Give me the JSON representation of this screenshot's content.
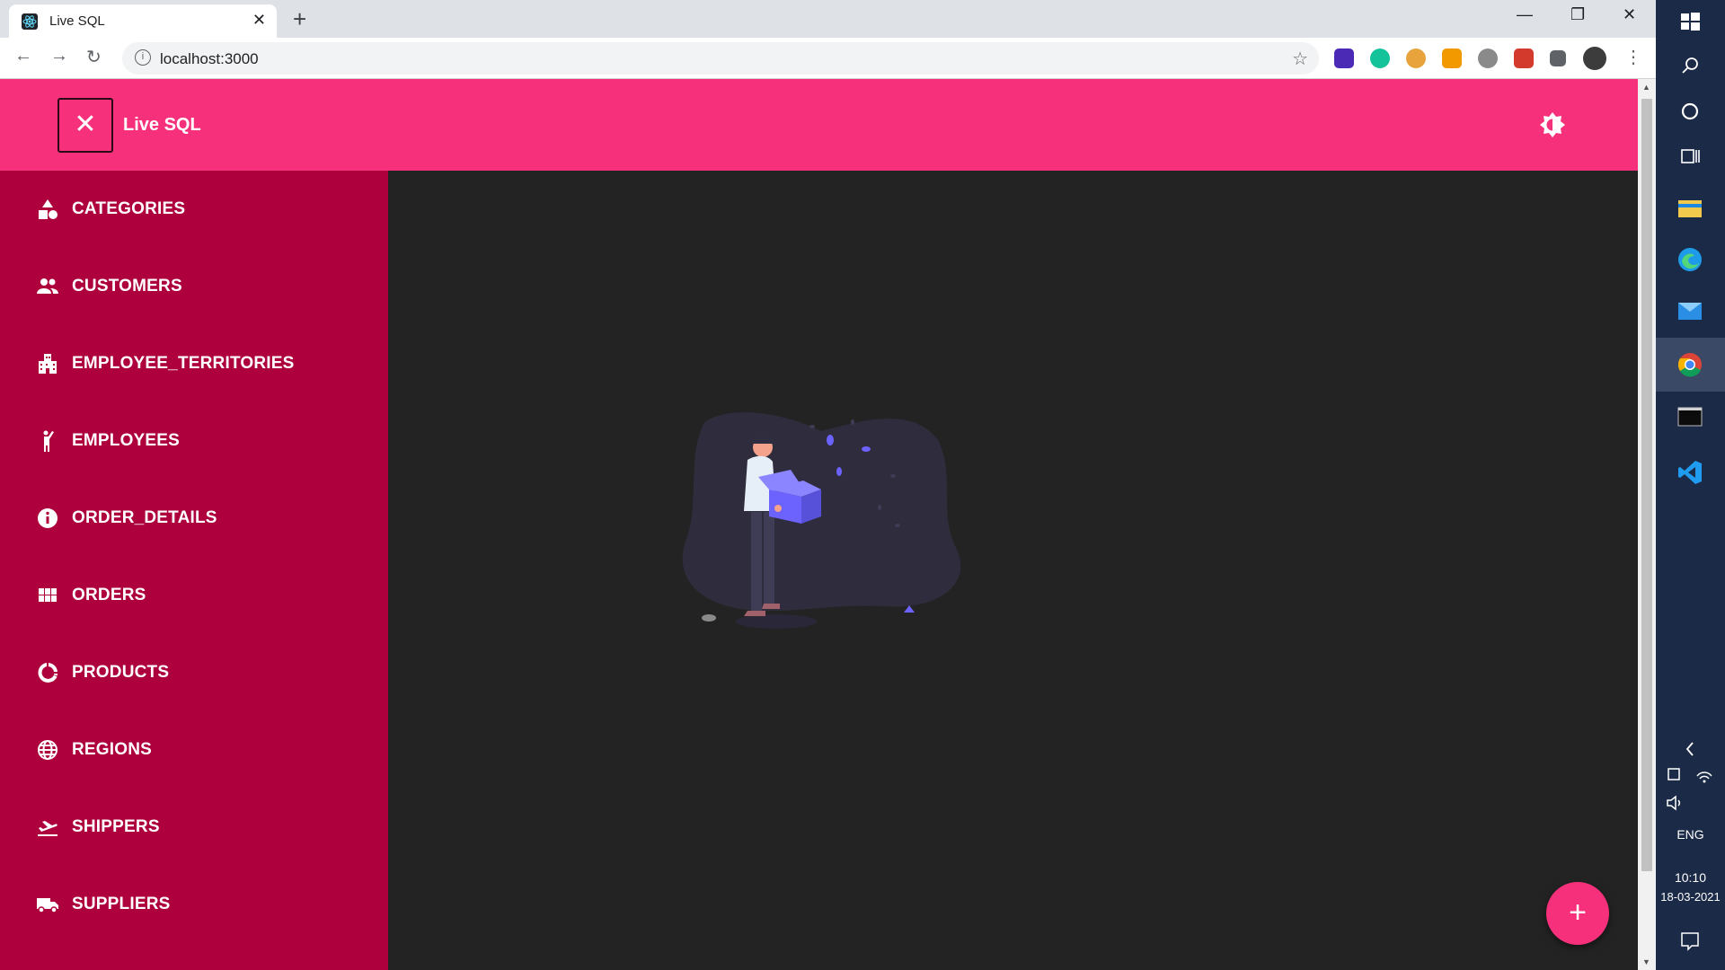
{
  "browser": {
    "tab_title": "Live SQL",
    "tab_close": "✕",
    "new_tab": "+",
    "url": "localhost:3000",
    "minimize": "—",
    "restore": "❐",
    "close": "✕"
  },
  "app": {
    "title": "Live SQL",
    "close_glyph": "✕",
    "accent_color": "#f7307b",
    "sidebar_color": "#ad003c"
  },
  "sidebar": {
    "items": [
      {
        "label": "CATEGORIES",
        "icon": "shapes-icon"
      },
      {
        "label": "CUSTOMERS",
        "icon": "people-icon"
      },
      {
        "label": "EMPLOYEE_TERRITORIES",
        "icon": "building-icon"
      },
      {
        "label": "EMPLOYEES",
        "icon": "person-raise-icon"
      },
      {
        "label": "ORDER_DETAILS",
        "icon": "info-icon"
      },
      {
        "label": "ORDERS",
        "icon": "grid-icon"
      },
      {
        "label": "PRODUCTS",
        "icon": "donut-icon"
      },
      {
        "label": "REGIONS",
        "icon": "globe-icon"
      },
      {
        "label": "SHIPPERS",
        "icon": "flight-takeoff-icon"
      },
      {
        "label": "SUPPLIERS",
        "icon": "truck-icon"
      }
    ]
  },
  "main": {
    "fab_label": "+"
  },
  "taskbar": {
    "language": "ENG",
    "time": "10:10",
    "date": "18-03-2021"
  }
}
